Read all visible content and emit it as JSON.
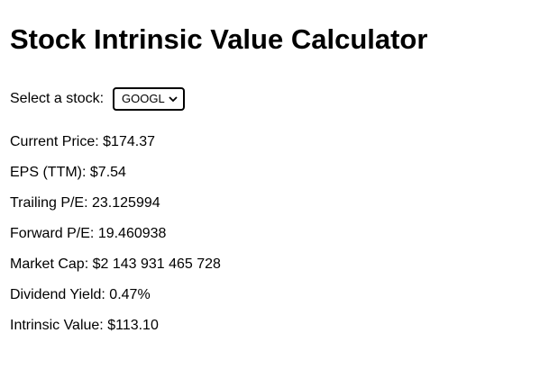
{
  "page": {
    "title": "Stock Intrinsic Value Calculator"
  },
  "selector": {
    "label": "Select a stock:",
    "selected": "GOOGL"
  },
  "metrics": [
    {
      "label": "Current Price:",
      "value": "$174.37"
    },
    {
      "label": "EPS (TTM):",
      "value": "$7.54"
    },
    {
      "label": "Trailing P/E:",
      "value": "23.125994"
    },
    {
      "label": "Forward P/E:",
      "value": "19.460938"
    },
    {
      "label": "Market Cap:",
      "value": "$2 143 931 465 728"
    },
    {
      "label": "Dividend Yield:",
      "value": "0.47%"
    },
    {
      "label": "Intrinsic Value:",
      "value": "$113.10"
    }
  ]
}
